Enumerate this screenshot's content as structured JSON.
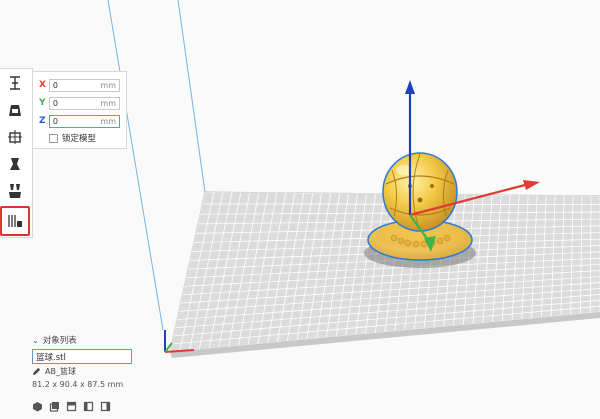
{
  "toolbar": {
    "tools": [
      {
        "name": "move-tool",
        "icon": "move-icon"
      },
      {
        "name": "scale-tool",
        "icon": "scale-icon"
      },
      {
        "name": "rotate-tool",
        "icon": "rotate-icon"
      },
      {
        "name": "mirror-tool",
        "icon": "mirror-icon"
      },
      {
        "name": "per-model-settings-tool",
        "icon": "per-model-settings-icon"
      },
      {
        "name": "support-blocker-tool",
        "icon": "support-blocker-icon",
        "active": true
      }
    ]
  },
  "move_panel": {
    "x": {
      "label": "X",
      "value": "0",
      "unit": "mm",
      "color": "#e03c31"
    },
    "y": {
      "label": "Y",
      "value": "0",
      "unit": "mm",
      "color": "#3bb54a"
    },
    "z": {
      "label": "Z",
      "value": "0",
      "unit": "mm",
      "color": "#2a5bd7"
    },
    "lock_label": "锁定模型"
  },
  "object_list": {
    "header": "对象列表",
    "file": "篮球.stl"
  },
  "object_info": {
    "name": "AB_篮球",
    "dimensions": "81.2 x 90.4 x 87.5 mm"
  },
  "colors": {
    "model": "#f2c94c",
    "model_shadow": "#c9952a",
    "outline": "#2b7bd6",
    "grid_line": "#bfbfbf",
    "plate": "#d9d9d9",
    "axis_x": "#e03c31",
    "axis_y": "#3bb54a",
    "axis_z": "#1f3fbf"
  }
}
